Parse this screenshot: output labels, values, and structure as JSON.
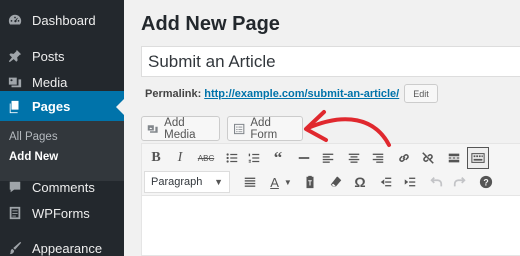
{
  "sidebar": {
    "items": [
      {
        "label": "Dashboard",
        "icon": "dashboard-icon"
      },
      {
        "label": "Posts",
        "icon": "pushpin-icon"
      },
      {
        "label": "Media",
        "icon": "media-icon"
      },
      {
        "label": "Pages",
        "icon": "pages-icon"
      },
      {
        "label": "Comments",
        "icon": "comment-icon"
      },
      {
        "label": "WPForms",
        "icon": "wpforms-icon"
      },
      {
        "label": "Appearance",
        "icon": "paintbrush-icon"
      }
    ],
    "submenu": [
      {
        "label": "All Pages"
      },
      {
        "label": "Add New"
      }
    ],
    "active_item": "Pages"
  },
  "page": {
    "title": "Add New Page",
    "post_title_value": "Submit an Article",
    "permalink_label": "Permalink:",
    "permalink_url": "http://example.com/submit-an-article/",
    "edit_label": "Edit"
  },
  "media_buttons": {
    "add_media": "Add Media",
    "add_form": "Add Form"
  },
  "editor": {
    "format_value": "Paragraph",
    "toolbar_row1": [
      "bold-icon",
      "italic-icon",
      "strikethrough-icon",
      "bullet-list-icon",
      "numbered-list-icon",
      "blockquote-icon",
      "horizontal-line-icon",
      "align-left-icon",
      "align-center-icon",
      "align-right-icon",
      "link-icon",
      "unlink-icon",
      "read-more-icon",
      "toolbar-toggle-icon"
    ],
    "toolbar_row2": [
      "paragraph-select",
      "justify-icon",
      "text-color-icon",
      "paste-text-icon",
      "clear-formatting-icon",
      "special-character-icon",
      "outdent-icon",
      "indent-icon",
      "undo-icon",
      "redo-icon",
      "help-icon"
    ]
  },
  "colors": {
    "sidebar_bg": "#23282d",
    "active_blue": "#0073aa",
    "annotation_red": "#e0282e"
  }
}
